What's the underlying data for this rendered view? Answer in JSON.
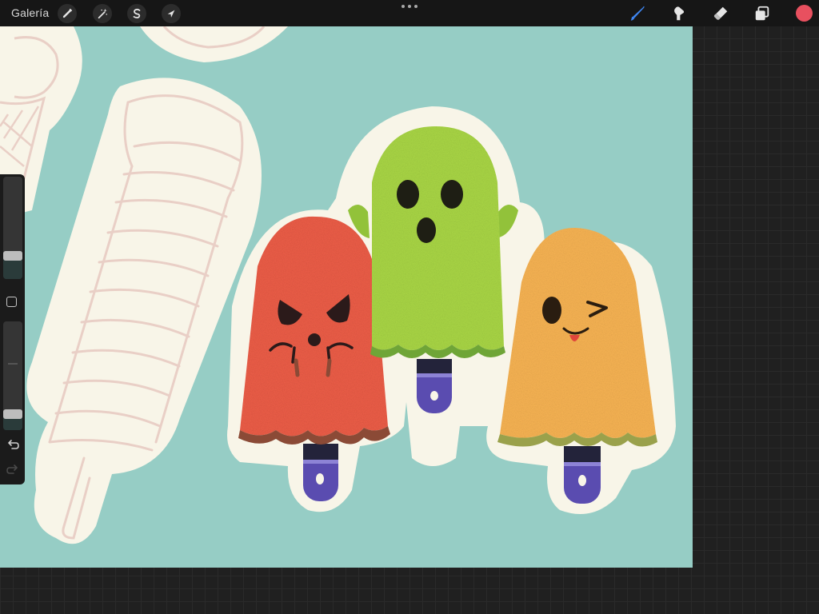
{
  "toolbar": {
    "gallery_label": "Galería",
    "left_tools": [
      {
        "icon": "wrench-icon",
        "name": "actions"
      },
      {
        "icon": "magic-wand-icon",
        "name": "adjustments"
      },
      {
        "icon": "selection-s-icon",
        "name": "selection"
      },
      {
        "icon": "arrow-cursor-icon",
        "name": "transform"
      }
    ],
    "right_tools": [
      {
        "icon": "brush-icon",
        "name": "paint",
        "active": true
      },
      {
        "icon": "smudge-icon",
        "name": "smudge",
        "active": false
      },
      {
        "icon": "eraser-icon",
        "name": "erase",
        "active": false
      },
      {
        "icon": "layers-icon",
        "name": "layers",
        "active": false
      }
    ],
    "active_color": "#e8505f",
    "active_tool_color": "#3f86f2"
  },
  "sidebar": {
    "brush_size_level": 0.23,
    "brush_opacity_level": 0.15
  },
  "canvas": {
    "background_color": "#96cdc5",
    "sticker_border_color": "#f8f5e8",
    "sketch_line_color": "#e9cfc6",
    "popsicles": [
      {
        "name": "angry",
        "color": "#ec5d47",
        "expression": "angry"
      },
      {
        "name": "happy",
        "color": "#a9d645",
        "expression": "surprised"
      },
      {
        "name": "wink",
        "color": "#f7b353",
        "expression": "wink-tongue"
      }
    ],
    "stick_color": "#5a4cb0"
  }
}
